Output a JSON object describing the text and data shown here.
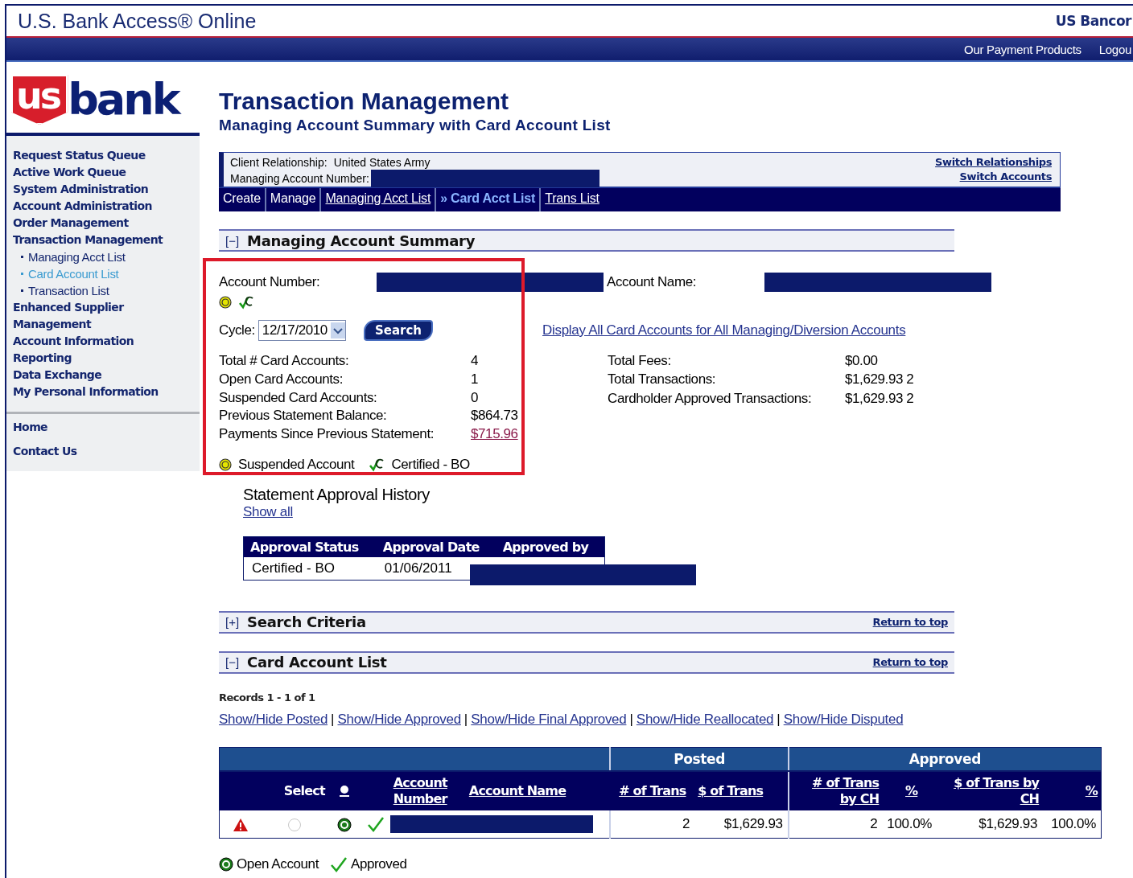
{
  "header": {
    "title": "U.S. Bank Access® Online",
    "brand": "US Bancor",
    "links": [
      "Our Payment Products",
      "Logou"
    ],
    "logo": {
      "mark": "us",
      "word": "bank"
    }
  },
  "sidebar": {
    "items": [
      {
        "label": "Request Status Queue",
        "kind": "main"
      },
      {
        "label": "Active Work Queue",
        "kind": "main"
      },
      {
        "label": "System Administration",
        "kind": "main"
      },
      {
        "label": "Account Administration",
        "kind": "main"
      },
      {
        "label": "Order Management",
        "kind": "main"
      },
      {
        "label": "Transaction Management",
        "kind": "main"
      },
      {
        "label": "Managing Acct List",
        "kind": "sub",
        "selected": false
      },
      {
        "label": "Card Account List",
        "kind": "sub",
        "selected": true
      },
      {
        "label": "Transaction List",
        "kind": "sub",
        "selected": false
      },
      {
        "label": "Enhanced Supplier Management",
        "kind": "main"
      },
      {
        "label": "Account Information",
        "kind": "main"
      },
      {
        "label": "Reporting",
        "kind": "main"
      },
      {
        "label": "Data Exchange",
        "kind": "main"
      },
      {
        "label": "My Personal Information",
        "kind": "main"
      }
    ],
    "bottom": [
      "Home",
      "Contact Us"
    ]
  },
  "title": "Transaction Management",
  "subtitle": "Managing Account Summary with Card Account List",
  "relationship": {
    "client_label": "Client Relationship:",
    "client_value": "United States Army",
    "account_label": "Managing Account Number:",
    "links": [
      "Switch Relationships",
      "Switch Accounts"
    ]
  },
  "tabs": [
    {
      "label": "Create",
      "kind": "plain",
      "selected": false
    },
    {
      "label": "Manage",
      "kind": "plain",
      "selected": false
    },
    {
      "label": "Managing Acct List",
      "kind": "link",
      "selected": false
    },
    {
      "label": "» Card Acct List",
      "kind": "link",
      "selected": true
    },
    {
      "label": "Trans List",
      "kind": "link",
      "selected": false
    }
  ],
  "summary": {
    "toggle": "[−]",
    "title": "Managing Account Summary",
    "account_number_label": "Account Number:",
    "account_name_label": "Account Name:",
    "cycle": {
      "label": "Cycle:",
      "value": "12/17/2010"
    },
    "search_button": "Search",
    "display_all_link": "Display All Card Accounts for All Managing/Diversion Accounts",
    "stats_left": [
      {
        "label": "Total # Card Accounts:",
        "value": "4",
        "link": false
      },
      {
        "label": "Open Card Accounts:",
        "value": "1",
        "link": false
      },
      {
        "label": "Suspended Card Accounts:",
        "value": "0",
        "link": false
      },
      {
        "label": "Previous Statement Balance:",
        "value": "$864.73",
        "link": false
      },
      {
        "label": "Payments Since Previous Statement:",
        "value": "$715.96",
        "link": true
      }
    ],
    "stats_right": [
      {
        "label": "Total Fees:",
        "value": "$0.00"
      },
      {
        "label": "Total Transactions:",
        "value": "$1,629.93 2"
      },
      {
        "label": "Cardholder Approved Transactions:",
        "value": "$1,629.93 2"
      }
    ],
    "legend": [
      "Suspended Account",
      "Certified - BO"
    ]
  },
  "approval_history": {
    "title": "Statement Approval History",
    "show_all": "Show all",
    "columns": [
      "Approval Status",
      "Approval Date",
      "Approved by"
    ],
    "rows": [
      [
        "Certified - BO",
        "01/06/2011"
      ]
    ]
  },
  "search_criteria": {
    "toggle": "[+]",
    "title": "Search Criteria",
    "return_link": "Return to top"
  },
  "card_list": {
    "toggle": "[−]",
    "title": "Card Account List",
    "return_link": "Return to top",
    "records": "Records 1 - 1 of 1",
    "separator": "|",
    "filters": [
      "Show/Hide Posted",
      "Show/Hide Approved",
      "Show/Hide Final Approved",
      "Show/Hide Reallocated",
      "Show/Hide Disputed"
    ],
    "groups": [
      "Posted",
      "Approved"
    ],
    "columns": [
      "Select",
      "Account Number",
      "Account Name",
      "# of Trans",
      "$ of Trans",
      "# of Trans by CH",
      "%",
      "$ of Trans by CH",
      "%"
    ],
    "rows": [
      {
        "selected": false,
        "posted_count": "2",
        "posted_amount": "$1,629.93",
        "approved_count": "2",
        "approved_count_pct": "100.0%",
        "approved_amount": "$1,629.93",
        "approved_amount_pct": "100.0%"
      }
    ],
    "legend": [
      "Open Account",
      "Approved"
    ]
  }
}
